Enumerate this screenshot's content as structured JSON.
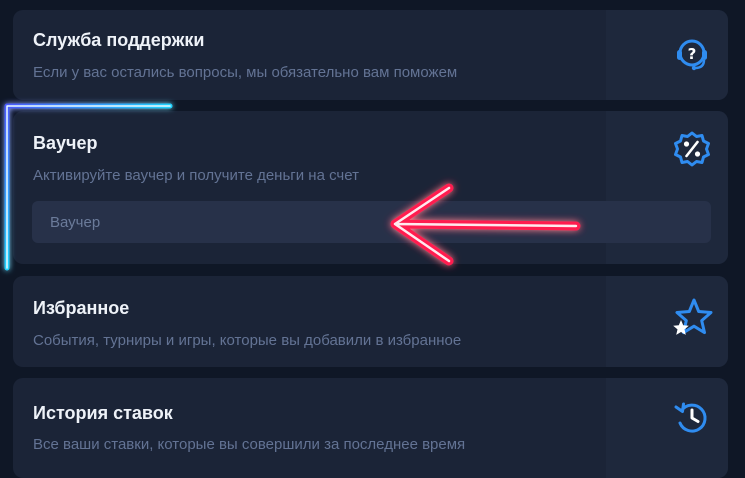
{
  "support": {
    "title": "Служба поддержки",
    "subtitle": "Если у вас остались вопросы, мы обязательно вам поможем",
    "icon": "headset-question-icon"
  },
  "voucher": {
    "title": "Ваучер",
    "subtitle": "Активируйте ваучер и получите деньги на счет",
    "input_placeholder": "Ваучер",
    "icon": "percent-badge-icon"
  },
  "favorites": {
    "title": "Избранное",
    "subtitle": "События, турниры и игры, которые вы добавили в избранное",
    "icon": "star-icon"
  },
  "bet_history": {
    "title": "История ставок",
    "subtitle": "Все ваши ставки, которые вы совершили за последнее время",
    "icon": "history-clock-icon"
  },
  "colors": {
    "background": "#0f1726",
    "card": "#1b2437",
    "card_icon_area": "#1e283c",
    "input": "#273149",
    "icon_accent": "#2f8cf0",
    "title_text": "#eef2f8",
    "subtitle_text": "#637394",
    "neon_bracket": "#29e0ff",
    "neon_arrow": "#ff2b55"
  }
}
